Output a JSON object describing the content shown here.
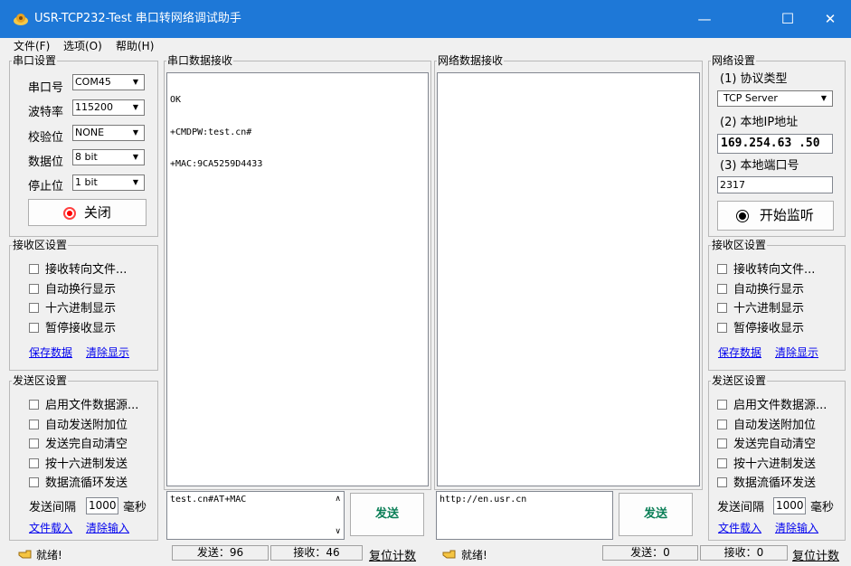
{
  "window": {
    "title": "USR-TCP232-Test 串口转网络调试助手",
    "minimize_glyph": "—",
    "maximize_glyph": "☐",
    "close_glyph": "✕"
  },
  "menu": [
    "文件(F)",
    "选项(O)",
    "帮助(H)"
  ],
  "serial_settings": {
    "legend": "串口设置",
    "port_label": "串口号",
    "port_value": "COM45",
    "baud_label": "波特率",
    "baud_value": "115200",
    "parity_label": "校验位",
    "parity_value": "NONE",
    "databits_label": "数据位",
    "databits_value": "8 bit",
    "stopbits_label": "停止位",
    "stopbits_value": "1 bit",
    "close_button": "关闭"
  },
  "serial_receive_settings": {
    "legend": "接收区设置",
    "options": [
      "接收转向文件...",
      "自动换行显示",
      "十六进制显示",
      "暂停接收显示"
    ],
    "save_link": "保存数据",
    "clear_link": "清除显示"
  },
  "serial_send_settings": {
    "legend": "发送区设置",
    "options": [
      "启用文件数据源...",
      "自动发送附加位",
      "发送完自动清空",
      "按十六进制发送",
      "数据流循环发送"
    ],
    "interval_label": "发送间隔",
    "interval_value": "1000",
    "interval_unit": "毫秒",
    "load_link": "文件载入",
    "clear_link": "清除输入"
  },
  "serial_receive": {
    "legend": "串口数据接收",
    "lines": [
      "OK",
      "+CMDPW:test.cn#",
      "+MAC:9CA5259D4433"
    ]
  },
  "network_receive": {
    "legend": "网络数据接收"
  },
  "serial_send": {
    "text": "test.cn#AT+MAC",
    "send_button": "发送"
  },
  "network_send": {
    "text": "http://en.usr.cn",
    "send_button": "发送"
  },
  "network_settings": {
    "legend": "网络设置",
    "protocol_label": "(1) 协议类型",
    "protocol_value": "TCP Server",
    "ip_label": "(2) 本地IP地址",
    "ip_value": "169.254.63 .50",
    "port_label": "(3) 本地端口号",
    "port_value": "2317",
    "start_button": "开始监听"
  },
  "net_receive_settings": {
    "legend": "接收区设置",
    "options": [
      "接收转向文件...",
      "自动换行显示",
      "十六进制显示",
      "暂停接收显示"
    ],
    "save_link": "保存数据",
    "clear_link": "清除显示"
  },
  "net_send_settings": {
    "legend": "发送区设置",
    "options": [
      "启用文件数据源...",
      "自动发送附加位",
      "发送完自动清空",
      "按十六进制发送",
      "数据流循环发送"
    ],
    "interval_label": "发送间隔",
    "interval_value": "1000",
    "interval_unit": "毫秒",
    "load_link": "文件载入",
    "clear_link": "清除输入"
  },
  "status": {
    "serial_ready": "就绪!",
    "serial_sent": "发送：96",
    "serial_received": "接收：46",
    "serial_reset": "复位计数",
    "net_ready": "就绪!",
    "net_sent": "发送：0",
    "net_received": "接收：0",
    "net_reset": "复位计数"
  }
}
